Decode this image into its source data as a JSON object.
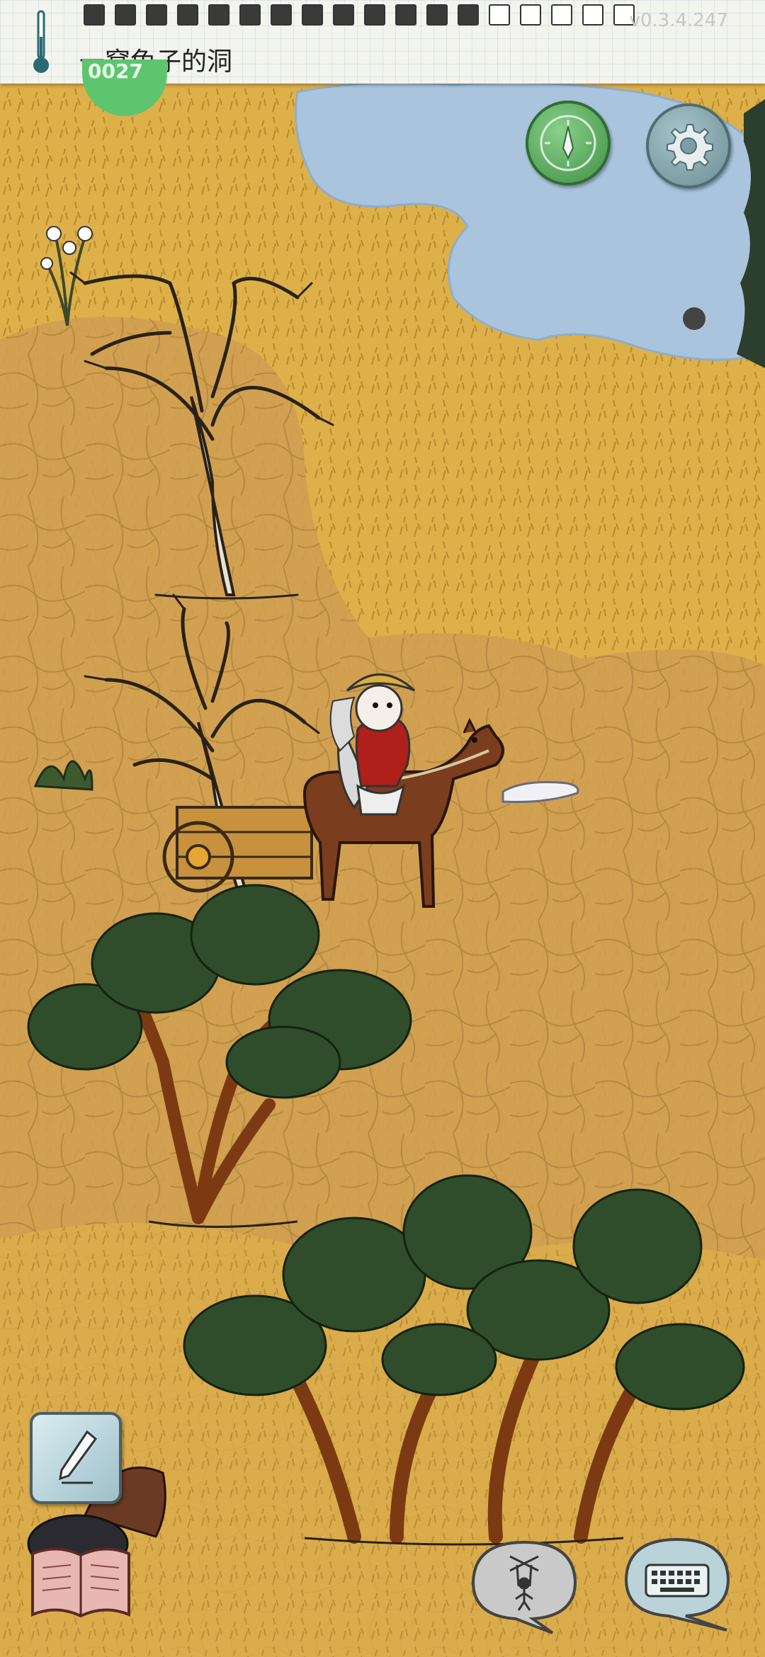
{
  "hud": {
    "location_name": "一窝兔子的洞",
    "version": "v0.3.4.247",
    "temperature_badge": "0027",
    "food_pips_total": 18,
    "food_pips_filled": 13
  },
  "icons": {
    "thermometer": "thermometer-icon",
    "compass": "compass-icon",
    "settings": "gear-icon",
    "pencil": "pencil-icon",
    "book": "book-icon",
    "puppet": "puppet-icon",
    "keyboard": "keyboard-icon"
  },
  "colors": {
    "grass": "#d9a94a",
    "dirt": "#c99a4a",
    "water": "#a9c4dc",
    "compass_green": "#4f9f54",
    "settings_teal": "#7f9ea3"
  }
}
